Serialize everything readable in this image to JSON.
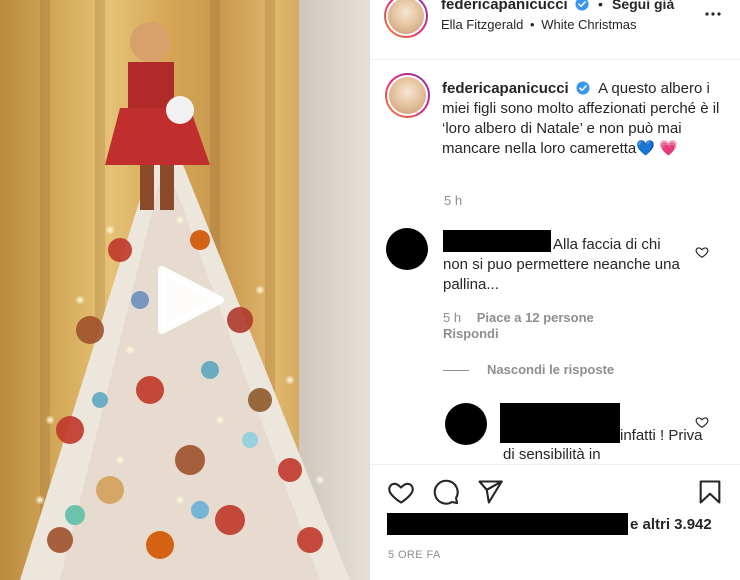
{
  "header": {
    "username": "federicapanicucci",
    "follow_label": "Segui già",
    "dot": "•",
    "song_artist": "Ella Fitzgerald",
    "song_sep": "•",
    "song_title": "White Christmas"
  },
  "caption": {
    "username": "federicapanicucci",
    "text": "A questo albero i miei figli sono molto affezionati perché è il ‘loro albero di Natale’ e non può mai mancare nella loro cameretta💙 💗",
    "time": "5 h"
  },
  "comments": [
    {
      "text": "Alla faccia di chi non si puo permettere neanche una pallina...",
      "time": "5 h",
      "likes": "Piace a 12 persone",
      "reply_label": "Rispondi",
      "hide_replies_label": "Nascondi le risposte"
    },
    {
      "text": "infatti ! Priva di sensibilità in"
    }
  ],
  "footer": {
    "likes_suffix": "e altri 3.942",
    "date": "5 ORE FA"
  },
  "icons": {
    "verified": "verified-badge",
    "more": "more-horizontal-icon",
    "like": "heart-icon",
    "comment": "comment-icon",
    "share": "paper-plane-icon",
    "save": "bookmark-icon",
    "play": "play-icon"
  },
  "colors": {
    "verified": "#3897f0",
    "text": "#262626",
    "muted": "#8e8e8e"
  }
}
